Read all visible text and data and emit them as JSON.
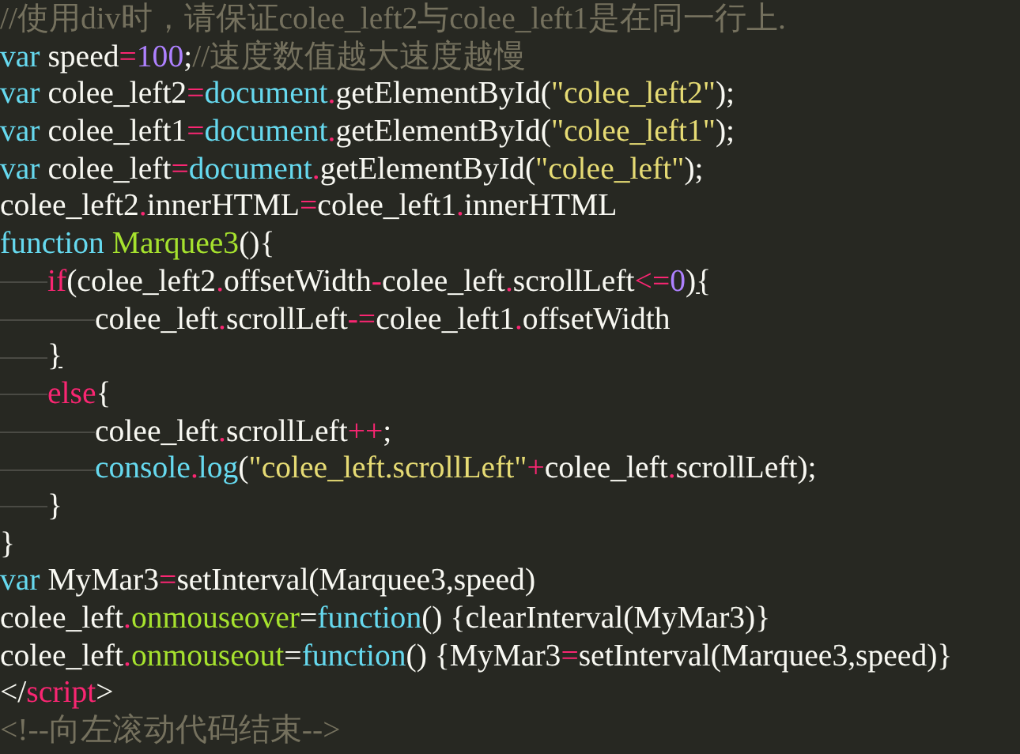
{
  "code_lines": [
    {
      "tokens": [
        {
          "text": "//使用div时，请保证colee_left2与colee_left1是在同一行上.",
          "kind": "comment"
        }
      ]
    },
    {
      "tokens": [
        {
          "text": "var",
          "kind": "keyword"
        },
        {
          "text": " speed",
          "kind": "plain"
        },
        {
          "text": "=",
          "kind": "operator"
        },
        {
          "text": "100",
          "kind": "number"
        },
        {
          "text": ";",
          "kind": "plain"
        },
        {
          "text": "//速度数值越大速度越慢",
          "kind": "comment"
        }
      ]
    },
    {
      "tokens": [
        {
          "text": "var",
          "kind": "keyword"
        },
        {
          "text": " colee_left2",
          "kind": "plain"
        },
        {
          "text": "=",
          "kind": "operator"
        },
        {
          "text": "document",
          "kind": "keyword"
        },
        {
          "text": ".",
          "kind": "operator"
        },
        {
          "text": "getElementById(",
          "kind": "plain"
        },
        {
          "text": "\"colee_left2\"",
          "kind": "string"
        },
        {
          "text": ");",
          "kind": "plain"
        }
      ]
    },
    {
      "tokens": [
        {
          "text": "var",
          "kind": "keyword"
        },
        {
          "text": " colee_left1",
          "kind": "plain"
        },
        {
          "text": "=",
          "kind": "operator"
        },
        {
          "text": "document",
          "kind": "keyword"
        },
        {
          "text": ".",
          "kind": "operator"
        },
        {
          "text": "getElementById(",
          "kind": "plain"
        },
        {
          "text": "\"colee_left1\"",
          "kind": "string"
        },
        {
          "text": ");",
          "kind": "plain"
        }
      ]
    },
    {
      "tokens": [
        {
          "text": "var",
          "kind": "keyword"
        },
        {
          "text": " colee_left",
          "kind": "plain"
        },
        {
          "text": "=",
          "kind": "operator"
        },
        {
          "text": "document",
          "kind": "keyword"
        },
        {
          "text": ".",
          "kind": "operator"
        },
        {
          "text": "getElementById(",
          "kind": "plain"
        },
        {
          "text": "\"colee_left\"",
          "kind": "string"
        },
        {
          "text": ");",
          "kind": "plain"
        }
      ]
    },
    {
      "tokens": [
        {
          "text": "colee_left2",
          "kind": "plain"
        },
        {
          "text": ".",
          "kind": "operator"
        },
        {
          "text": "innerHTML",
          "kind": "plain"
        },
        {
          "text": "=",
          "kind": "operator"
        },
        {
          "text": "colee_left1",
          "kind": "plain"
        },
        {
          "text": ".",
          "kind": "operator"
        },
        {
          "text": "innerHTML",
          "kind": "plain"
        }
      ]
    },
    {
      "tokens": [
        {
          "text": "function ",
          "kind": "keyword"
        },
        {
          "text": "Marquee3",
          "kind": "function_name"
        },
        {
          "text": "(){",
          "kind": "plain"
        }
      ],
      "children": [
        {
          "tokens": [
            {
              "text": "if",
              "kind": "operator"
            },
            {
              "text": "(colee_left2",
              "kind": "plain"
            },
            {
              "text": ".",
              "kind": "operator"
            },
            {
              "text": "offsetWidth",
              "kind": "plain"
            },
            {
              "text": "-",
              "kind": "operator"
            },
            {
              "text": "colee_left",
              "kind": "plain"
            },
            {
              "text": ".",
              "kind": "operator"
            },
            {
              "text": "scrollLeft",
              "kind": "plain"
            },
            {
              "text": "<=",
              "kind": "operator"
            },
            {
              "text": "0",
              "kind": "number"
            },
            {
              "text": ")",
              "kind": "plain"
            },
            {
              "text": "{",
              "kind": "matched_bracket"
            }
          ],
          "children": [
            {
              "tokens": [
                {
                  "text": "colee_left",
                  "kind": "plain"
                },
                {
                  "text": ".",
                  "kind": "operator"
                },
                {
                  "text": "scrollLeft",
                  "kind": "plain"
                },
                {
                  "text": "-=",
                  "kind": "operator"
                },
                {
                  "text": "colee_left1",
                  "kind": "plain"
                },
                {
                  "text": ".",
                  "kind": "operator"
                },
                {
                  "text": "offsetWidth",
                  "kind": "plain"
                }
              ]
            }
          ]
        },
        {
          "tokens": [
            {
              "text": "}",
              "kind": "matched_bracket"
            }
          ]
        },
        {
          "tokens": [
            {
              "text": "else",
              "kind": "operator"
            },
            {
              "text": "{",
              "kind": "plain"
            }
          ],
          "children": [
            {
              "tokens": [
                {
                  "text": "colee_left",
                  "kind": "plain"
                },
                {
                  "text": ".",
                  "kind": "operator"
                },
                {
                  "text": "scrollLeft",
                  "kind": "plain"
                },
                {
                  "text": "++",
                  "kind": "operator"
                },
                {
                  "text": ";",
                  "kind": "plain"
                }
              ]
            },
            {
              "tokens": [
                {
                  "text": "console",
                  "kind": "keyword"
                },
                {
                  "text": ".",
                  "kind": "operator"
                },
                {
                  "text": "log",
                  "kind": "keyword"
                },
                {
                  "text": "(",
                  "kind": "plain"
                },
                {
                  "text": "\"colee_left.scrollLeft\"",
                  "kind": "string"
                },
                {
                  "text": "+",
                  "kind": "operator"
                },
                {
                  "text": "colee_left",
                  "kind": "plain"
                },
                {
                  "text": ".",
                  "kind": "operator"
                },
                {
                  "text": "scrollLeft);",
                  "kind": "plain"
                }
              ]
            }
          ]
        },
        {
          "tokens": [
            {
              "text": "}",
              "kind": "plain"
            }
          ]
        }
      ]
    },
    {
      "tokens": [
        {
          "text": "}",
          "kind": "plain"
        }
      ]
    },
    {
      "tokens": [
        {
          "text": "var",
          "kind": "keyword"
        },
        {
          "text": " MyMar3",
          "kind": "plain"
        },
        {
          "text": "=",
          "kind": "operator"
        },
        {
          "text": "setInterval(Marquee3,speed)",
          "kind": "plain"
        }
      ]
    },
    {
      "tokens": [
        {
          "text": "colee_left",
          "kind": "plain"
        },
        {
          "text": ".",
          "kind": "operator"
        },
        {
          "text": "onmouseover",
          "kind": "function_name"
        },
        {
          "text": "=",
          "kind": "plain"
        },
        {
          "text": "function",
          "kind": "keyword"
        },
        {
          "text": "() {clearInterval(MyMar3)}",
          "kind": "plain"
        }
      ]
    },
    {
      "tokens": [
        {
          "text": "colee_left",
          "kind": "plain"
        },
        {
          "text": ".",
          "kind": "operator"
        },
        {
          "text": "onmouseout",
          "kind": "function_name"
        },
        {
          "text": "=",
          "kind": "plain"
        },
        {
          "text": "function",
          "kind": "keyword"
        },
        {
          "text": "() {MyMar3",
          "kind": "plain"
        },
        {
          "text": "=",
          "kind": "operator"
        },
        {
          "text": "setInterval(Marquee3,speed)}",
          "kind": "plain"
        }
      ]
    },
    {
      "tokens": [
        {
          "text": "</",
          "kind": "plain"
        },
        {
          "text": "script",
          "kind": "operator"
        },
        {
          "text": ">",
          "kind": "plain"
        }
      ]
    },
    {
      "tokens": [
        {
          "text": "<!--向左滚动代码结束-->",
          "kind": "comment"
        }
      ]
    }
  ]
}
